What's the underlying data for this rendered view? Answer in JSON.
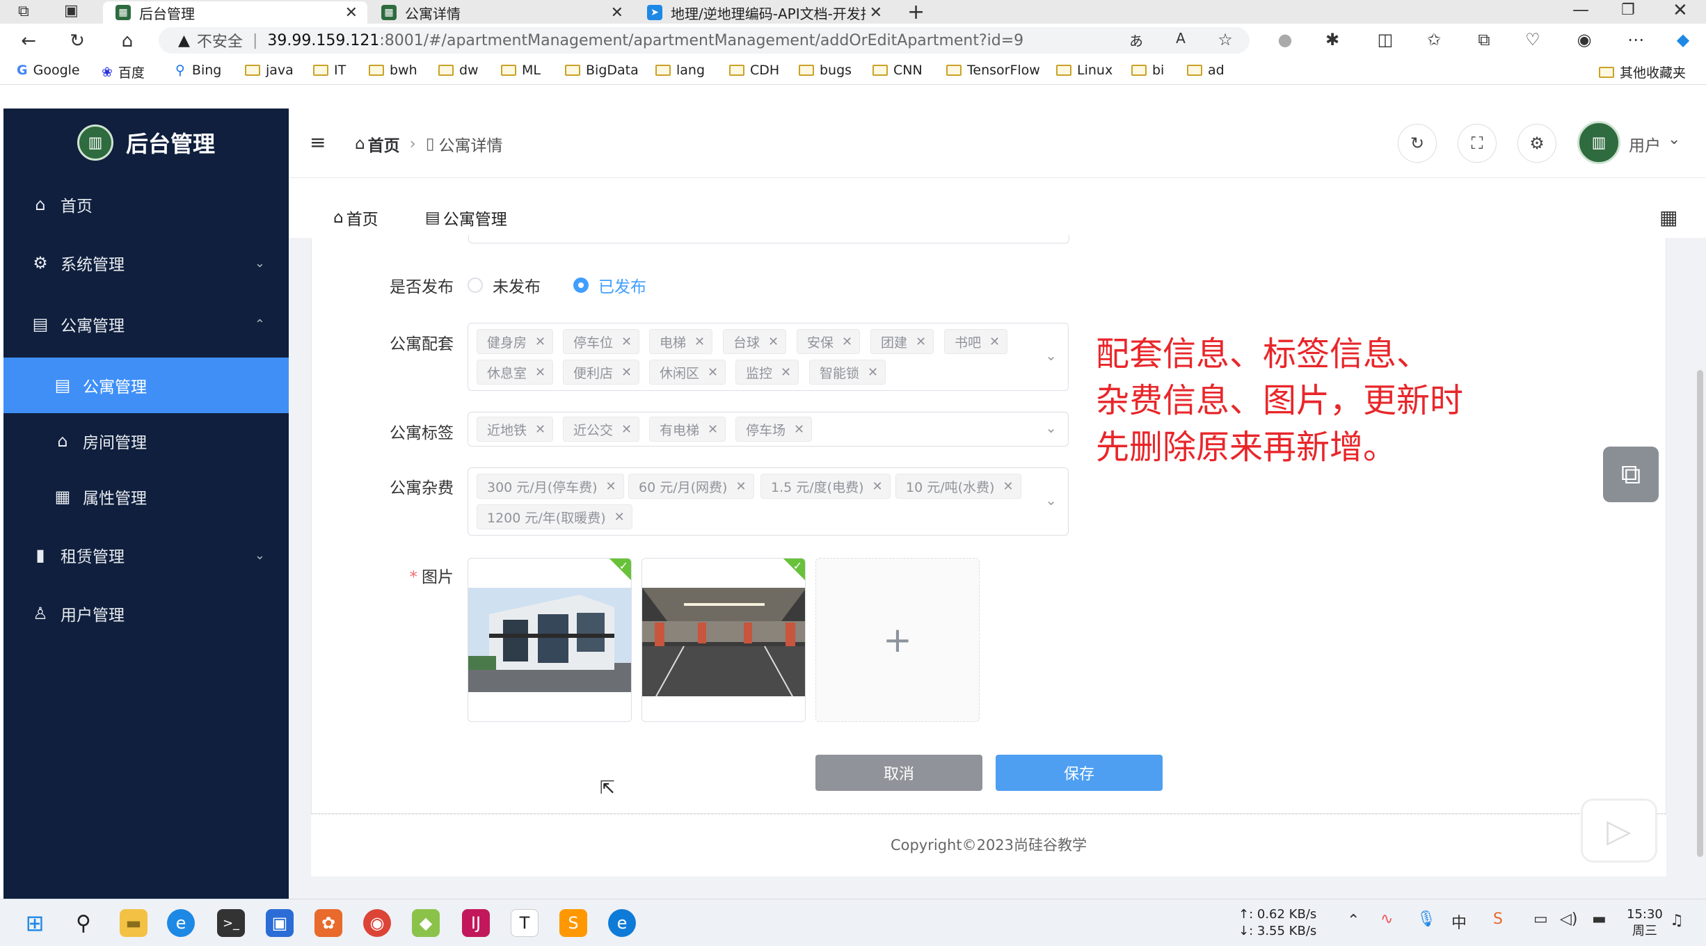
{
  "browser": {
    "tabs": [
      {
        "title": "后台管理",
        "active": true
      },
      {
        "title": "公寓详情",
        "active": false
      },
      {
        "title": "地理/逆地理编码-API文档-开发指",
        "active": false
      }
    ],
    "security_label": "不安全",
    "url_host": "39.99.159.121",
    "url_path": ":8001/#/apartmentManagement/apartmentManagement/addOrEditApartment?id=9",
    "bookmarks": [
      "Google",
      "百度",
      "Bing",
      "java",
      "IT",
      "bwh",
      "dw",
      "ML",
      "BigData",
      "lang",
      "CDH",
      "bugs",
      "CNN",
      "TensorFlow",
      "Linux",
      "bi",
      "ad"
    ],
    "other_bookmarks": "其他收藏夹"
  },
  "sidebar": {
    "title": "后台管理",
    "items": [
      {
        "label": "首页",
        "icon": "home-icon"
      },
      {
        "label": "系统管理",
        "icon": "gear-icon"
      },
      {
        "label": "公寓管理",
        "icon": "building-icon"
      },
      {
        "label": "公寓管理",
        "icon": "building-icon",
        "sub": true,
        "active": true
      },
      {
        "label": "房间管理",
        "icon": "house-icon",
        "sub": true
      },
      {
        "label": "属性管理",
        "icon": "clipboard-icon",
        "sub": true
      },
      {
        "label": "租赁管理",
        "icon": "chart-icon"
      },
      {
        "label": "用户管理",
        "icon": "user-icon"
      }
    ]
  },
  "header": {
    "breadcrumb": [
      "首页",
      "公寓详情"
    ],
    "user_label": "用户"
  },
  "tags_view": [
    "首页",
    "公寓管理"
  ],
  "form": {
    "published_label": "是否发布",
    "published_options": [
      "未发布",
      "已发布"
    ],
    "published_value": "已发布",
    "facilities_label": "公寓配套",
    "facilities": [
      "健身房",
      "停车位",
      "电梯",
      "台球",
      "安保",
      "团建",
      "书吧",
      "休息室",
      "便利店",
      "休闲区",
      "监控",
      "智能锁"
    ],
    "labels_label": "公寓标签",
    "labels": [
      "近地铁",
      "近公交",
      "有电梯",
      "停车场"
    ],
    "fees_label": "公寓杂费",
    "fees": [
      "300 元/月(停车费)",
      "60 元/月(网费)",
      "1.5 元/度(电费)",
      "10 元/吨(水费)",
      "1200 元/年(取暖费)"
    ],
    "images_label": "图片",
    "cancel_label": "取消",
    "save_label": "保存"
  },
  "annotation": [
    "配套信息、标签信息、",
    "杂费信息、图片，更新时",
    "先删除原来再新增。"
  ],
  "footer": {
    "copyright": "Copyright©2023尚硅谷教学"
  },
  "taskbar": {
    "upload_speed": "↑: 0.62 KB/s",
    "download_speed": "↓: 3.55 KB/s",
    "time": "15:30",
    "weekday": "周三"
  },
  "colors": {
    "sidebar_bg": "#0f1f3d",
    "accent": "#409eff",
    "annotation": "#e8262a"
  }
}
